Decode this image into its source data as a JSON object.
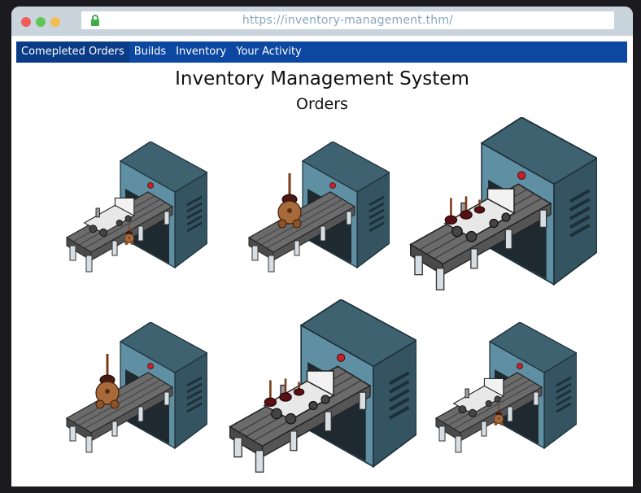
{
  "browser": {
    "url": "https://inventory-management.thm/"
  },
  "nav": {
    "items": [
      {
        "label": "Comepleted Orders",
        "active": true
      },
      {
        "label": "Builds",
        "active": false
      },
      {
        "label": "Inventory",
        "active": false
      },
      {
        "label": "Your Activity",
        "active": false
      }
    ]
  },
  "header": {
    "title": "Inventory Management System",
    "subtitle": "Orders"
  },
  "orders": [
    {
      "product": "train-and-teddy",
      "size": "small"
    },
    {
      "product": "teddy-bear",
      "size": "small"
    },
    {
      "product": "train-and-plungers",
      "size": "large"
    },
    {
      "product": "teddy-bear",
      "size": "small"
    },
    {
      "product": "train-and-plungers",
      "size": "large"
    },
    {
      "product": "train-and-teddy",
      "size": "small"
    }
  ],
  "colors": {
    "nav_bg": "#0c48a1",
    "nav_active": "#093b86",
    "machine_front": "#5f8fa3",
    "machine_side": "#355462",
    "conveyor": "#6b6b6b"
  }
}
